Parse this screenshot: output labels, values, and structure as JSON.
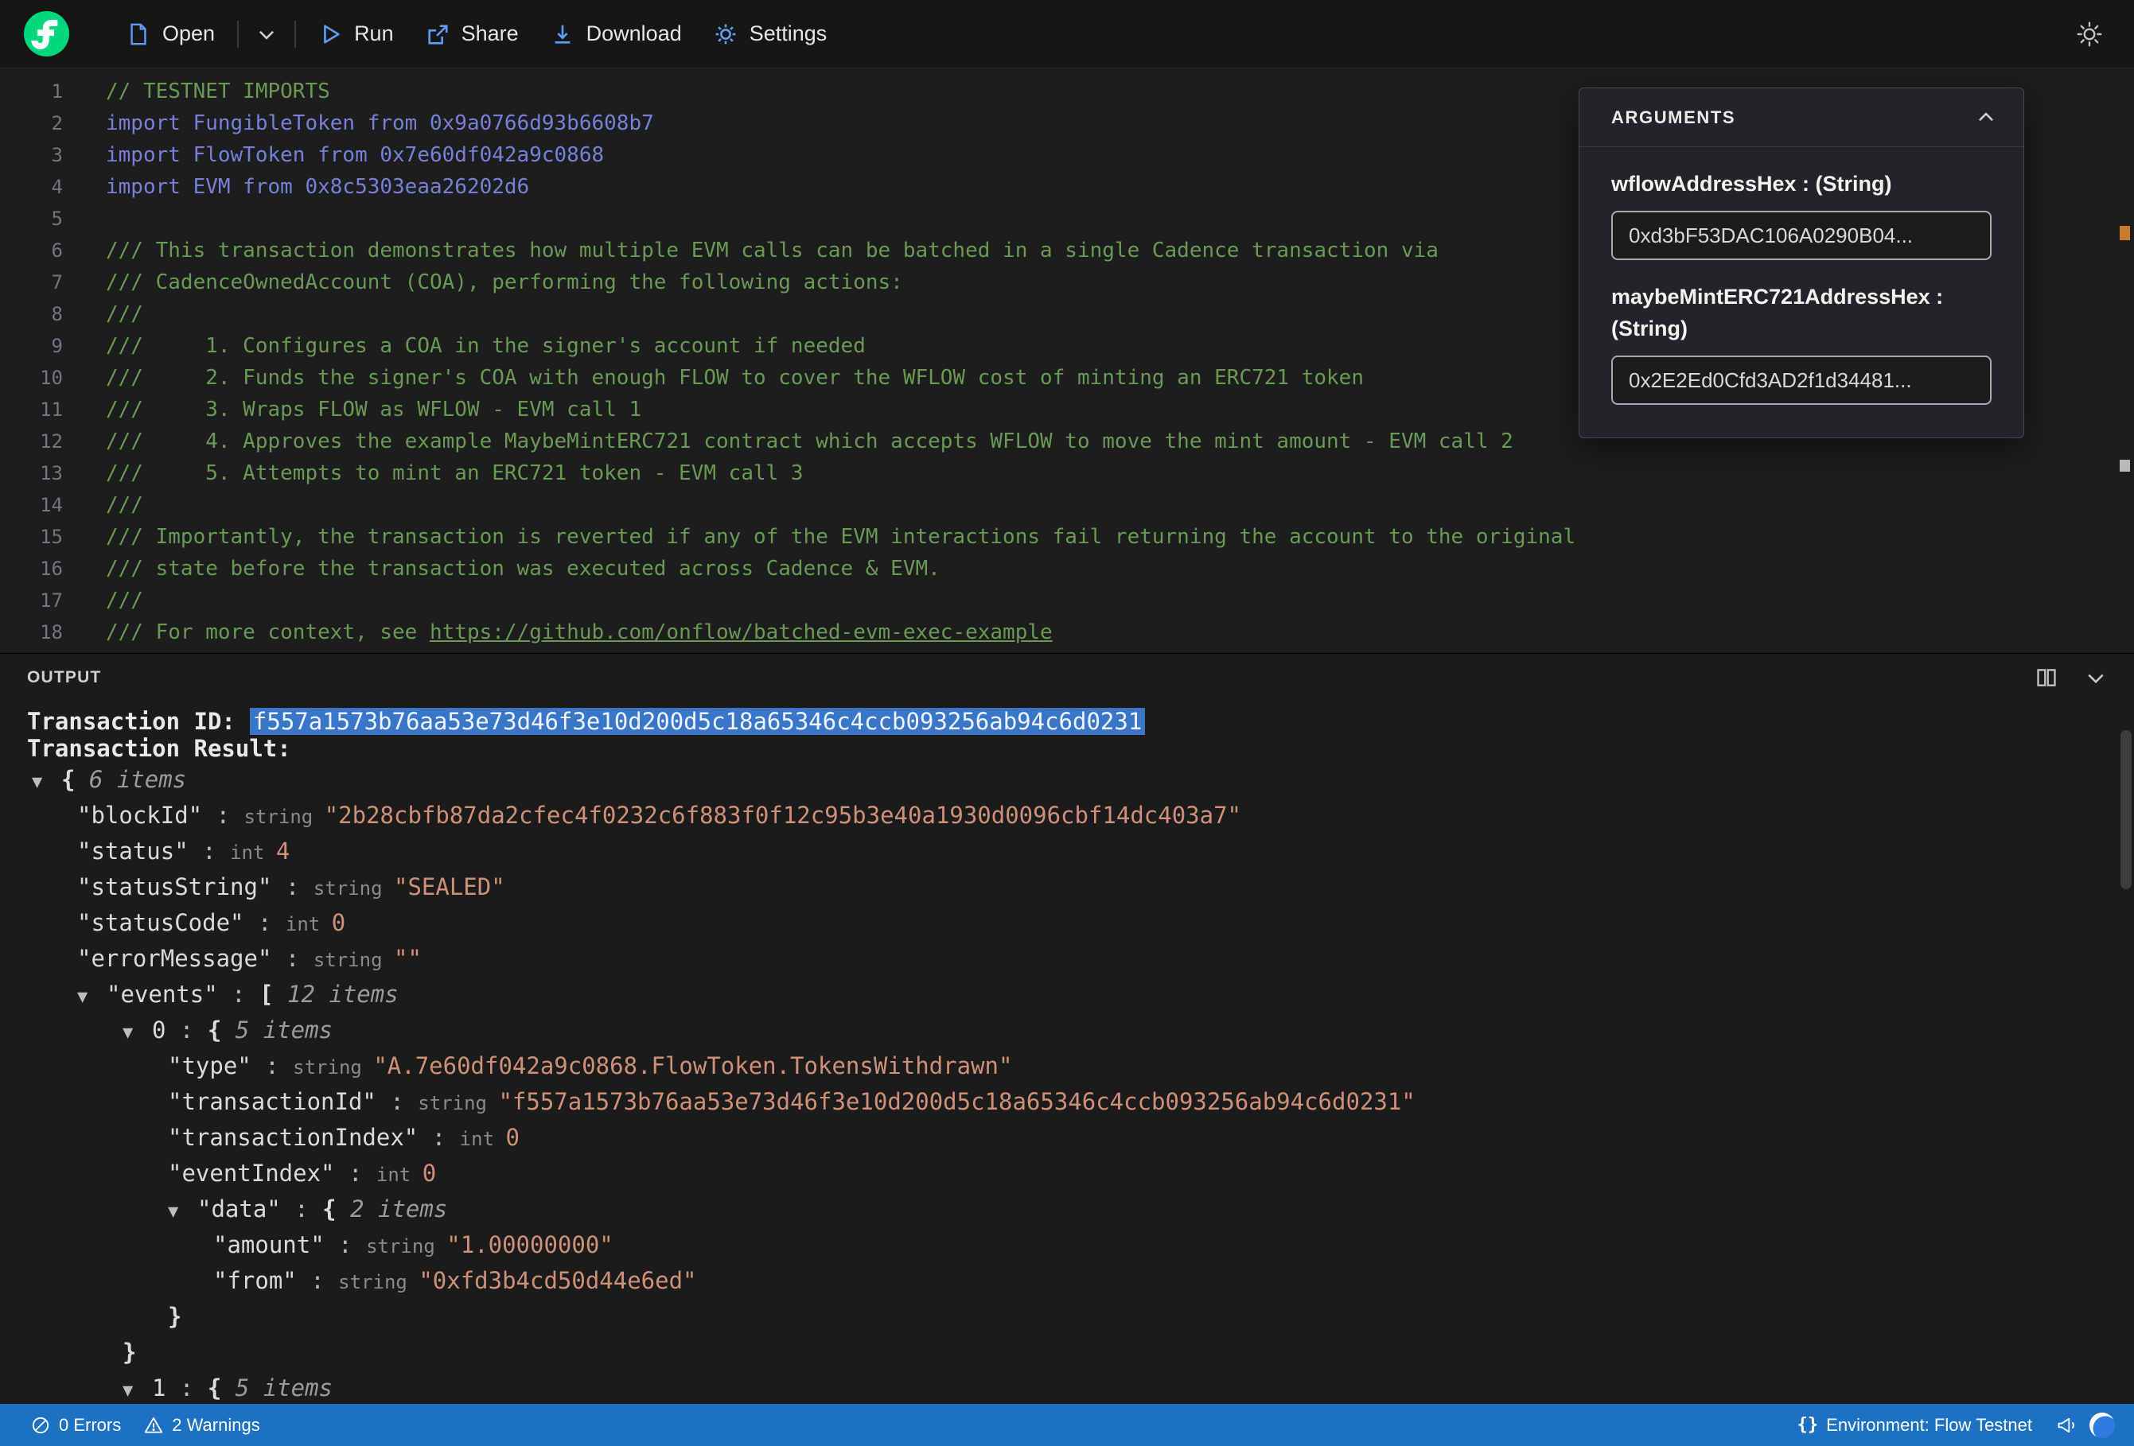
{
  "toolbar": {
    "open": "Open",
    "run": "Run",
    "share": "Share",
    "download": "Download",
    "settings": "Settings"
  },
  "editor": {
    "lines": [
      {
        "num": "1",
        "segments": [
          {
            "kind": "comment",
            "text": "// TESTNET IMPORTS"
          }
        ]
      },
      {
        "num": "2",
        "segments": [
          {
            "kind": "import",
            "text": "import FungibleToken from 0x9a0766d93b6608b7"
          }
        ]
      },
      {
        "num": "3",
        "segments": [
          {
            "kind": "import",
            "text": "import FlowToken from 0x7e60df042a9c0868"
          }
        ]
      },
      {
        "num": "4",
        "segments": [
          {
            "kind": "import",
            "text": "import EVM from 0x8c5303eaa26202d6"
          }
        ]
      },
      {
        "num": "5",
        "segments": []
      },
      {
        "num": "6",
        "segments": [
          {
            "kind": "comment",
            "text": "/// This transaction demonstrates how multiple EVM calls can be batched in a single Cadence transaction via"
          }
        ]
      },
      {
        "num": "7",
        "segments": [
          {
            "kind": "comment",
            "text": "/// CadenceOwnedAccount (COA), performing the following actions:"
          }
        ]
      },
      {
        "num": "8",
        "segments": [
          {
            "kind": "comment",
            "text": "///"
          }
        ]
      },
      {
        "num": "9",
        "segments": [
          {
            "kind": "comment",
            "text": "///     1. Configures a COA in the signer's account if needed"
          }
        ]
      },
      {
        "num": "10",
        "segments": [
          {
            "kind": "comment",
            "text": "///     2. Funds the signer's COA with enough FLOW to cover the WFLOW cost of minting an ERC721 token"
          }
        ]
      },
      {
        "num": "11",
        "segments": [
          {
            "kind": "comment",
            "text": "///     3. Wraps FLOW as WFLOW - EVM call 1"
          }
        ]
      },
      {
        "num": "12",
        "segments": [
          {
            "kind": "comment",
            "text": "///     4. Approves the example MaybeMintERC721 contract which accepts WFLOW to move the mint amount - EVM call 2"
          }
        ]
      },
      {
        "num": "13",
        "segments": [
          {
            "kind": "comment",
            "text": "///     5. Attempts to mint an ERC721 token - EVM call 3"
          }
        ]
      },
      {
        "num": "14",
        "segments": [
          {
            "kind": "comment",
            "text": "///"
          }
        ]
      },
      {
        "num": "15",
        "segments": [
          {
            "kind": "comment",
            "text": "/// Importantly, the transaction is reverted if any of the EVM interactions fail returning the account to the original"
          }
        ]
      },
      {
        "num": "16",
        "segments": [
          {
            "kind": "comment",
            "text": "/// state before the transaction was executed across Cadence & EVM."
          }
        ]
      },
      {
        "num": "17",
        "segments": [
          {
            "kind": "comment",
            "text": "///"
          }
        ]
      },
      {
        "num": "18",
        "segments": [
          {
            "kind": "comment",
            "text": "/// For more context, see "
          },
          {
            "kind": "link",
            "text": "https://github.com/onflow/batched-evm-exec-example"
          }
        ]
      }
    ]
  },
  "arguments_panel": {
    "title": "ARGUMENTS",
    "fields": [
      {
        "label": "wflowAddressHex : (String)",
        "value": "0xd3bF53DAC106A0290B04..."
      },
      {
        "label": "maybeMintERC721AddressHex : (String)",
        "value": "0x2E2Ed0Cfd3AD2f1d34481..."
      }
    ]
  },
  "output": {
    "title": "OUTPUT",
    "tx_id_label": "Transaction ID:",
    "tx_id": "f557a1573b76aa53e73d46f3e10d200d5c18a65346c4ccb093256ab94c6d0231",
    "tx_result_label": "Transaction Result:",
    "marker_glyph": "▼",
    "tree": [
      {
        "indent": 0,
        "marker": true,
        "parts": [
          [
            "brace",
            "{ "
          ],
          [
            "items",
            "6 items"
          ]
        ]
      },
      {
        "indent": 1,
        "marker": false,
        "parts": [
          [
            "key",
            "\"blockId\""
          ],
          [
            "colon",
            " : "
          ],
          [
            "type",
            "string "
          ],
          [
            "str",
            "\"2b28cbfb87da2cfec4f0232c6f883f0f12c95b3e40a1930d0096cbf14dc403a7\""
          ]
        ]
      },
      {
        "indent": 1,
        "marker": false,
        "parts": [
          [
            "key",
            "\"status\""
          ],
          [
            "colon",
            " : "
          ],
          [
            "type",
            "int "
          ],
          [
            "num",
            "4"
          ]
        ]
      },
      {
        "indent": 1,
        "marker": false,
        "parts": [
          [
            "key",
            "\"statusString\""
          ],
          [
            "colon",
            " : "
          ],
          [
            "type",
            "string "
          ],
          [
            "str",
            "\"SEALED\""
          ]
        ]
      },
      {
        "indent": 1,
        "marker": false,
        "parts": [
          [
            "key",
            "\"statusCode\""
          ],
          [
            "colon",
            " : "
          ],
          [
            "type",
            "int "
          ],
          [
            "num",
            "0"
          ]
        ]
      },
      {
        "indent": 1,
        "marker": false,
        "parts": [
          [
            "key",
            "\"errorMessage\""
          ],
          [
            "colon",
            " : "
          ],
          [
            "type",
            "string "
          ],
          [
            "str",
            "\"\""
          ]
        ]
      },
      {
        "indent": 1,
        "marker": true,
        "parts": [
          [
            "key",
            "\"events\""
          ],
          [
            "colon",
            " : "
          ],
          [
            "brace",
            "[ "
          ],
          [
            "items",
            "12 items"
          ]
        ]
      },
      {
        "indent": 2,
        "marker": true,
        "parts": [
          [
            "idx",
            "0"
          ],
          [
            "colon",
            " : "
          ],
          [
            "brace",
            "{ "
          ],
          [
            "items",
            "5 items"
          ]
        ]
      },
      {
        "indent": 3,
        "marker": false,
        "parts": [
          [
            "key",
            "\"type\""
          ],
          [
            "colon",
            " : "
          ],
          [
            "type",
            "string "
          ],
          [
            "str",
            "\"A.7e60df042a9c0868.FlowToken.TokensWithdrawn\""
          ]
        ]
      },
      {
        "indent": 3,
        "marker": false,
        "parts": [
          [
            "key",
            "\"transactionId\""
          ],
          [
            "colon",
            " : "
          ],
          [
            "type",
            "string "
          ],
          [
            "str",
            "\"f557a1573b76aa53e73d46f3e10d200d5c18a65346c4ccb093256ab94c6d0231\""
          ]
        ]
      },
      {
        "indent": 3,
        "marker": false,
        "parts": [
          [
            "key",
            "\"transactionIndex\""
          ],
          [
            "colon",
            " : "
          ],
          [
            "type",
            "int "
          ],
          [
            "num",
            "0"
          ]
        ]
      },
      {
        "indent": 3,
        "marker": false,
        "parts": [
          [
            "key",
            "\"eventIndex\""
          ],
          [
            "colon",
            " : "
          ],
          [
            "type",
            "int "
          ],
          [
            "num",
            "0"
          ]
        ]
      },
      {
        "indent": 3,
        "marker": true,
        "parts": [
          [
            "key",
            "\"data\""
          ],
          [
            "colon",
            " : "
          ],
          [
            "brace",
            "{ "
          ],
          [
            "items",
            "2 items"
          ]
        ]
      },
      {
        "indent": 4,
        "marker": false,
        "parts": [
          [
            "key",
            "\"amount\""
          ],
          [
            "colon",
            " : "
          ],
          [
            "type",
            "string "
          ],
          [
            "str",
            "\"1.00000000\""
          ]
        ]
      },
      {
        "indent": 4,
        "marker": false,
        "parts": [
          [
            "key",
            "\"from\""
          ],
          [
            "colon",
            " : "
          ],
          [
            "type",
            "string "
          ],
          [
            "str",
            "\"0xfd3b4cd50d44e6ed\""
          ]
        ]
      },
      {
        "indent": 3,
        "marker": false,
        "parts": [
          [
            "brace",
            "}"
          ]
        ]
      },
      {
        "indent": 2,
        "marker": false,
        "parts": [
          [
            "brace",
            "}"
          ]
        ]
      },
      {
        "indent": 2,
        "marker": true,
        "parts": [
          [
            "idx",
            "1"
          ],
          [
            "colon",
            " : "
          ],
          [
            "brace",
            "{ "
          ],
          [
            "items",
            "5 items"
          ]
        ]
      }
    ]
  },
  "status_bar": {
    "errors": "0 Errors",
    "warnings": "2 Warnings",
    "environment": "Environment: Flow Testnet",
    "braces_icon": "{}"
  },
  "colors": {
    "accent_green": "#00d87e",
    "status_bar_blue": "#1d71c2",
    "selection_blue": "#3a76c8",
    "comment_green": "#6a9955",
    "import_blue": "#7680d8",
    "string_orange": "#ce9178"
  }
}
